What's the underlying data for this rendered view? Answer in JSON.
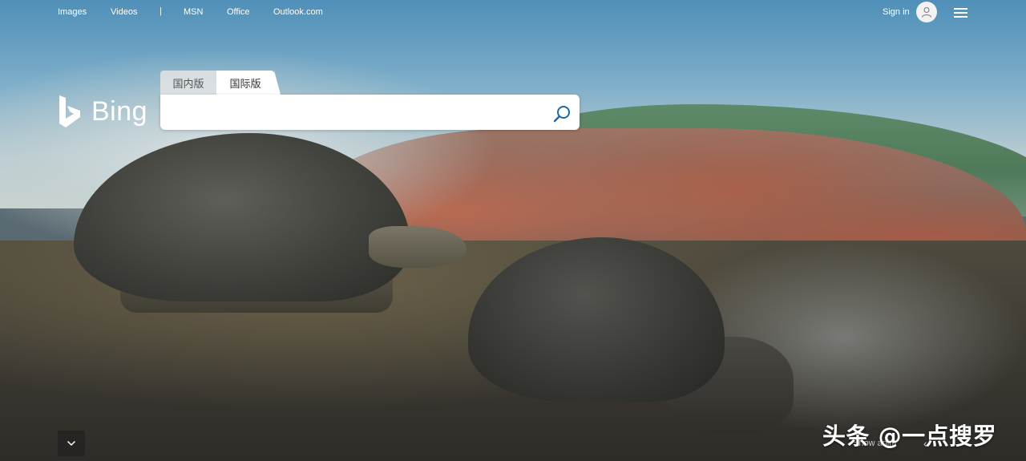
{
  "topnav": {
    "links": [
      "Images",
      "Videos",
      "MSN",
      "Office",
      "Outlook.com"
    ],
    "separator": "|",
    "signin_label": "Sign in"
  },
  "logo": {
    "text": "Bing"
  },
  "search": {
    "tabs": [
      {
        "label": "国内版",
        "active": false
      },
      {
        "label": "国际版",
        "active": true
      }
    ],
    "value": "",
    "placeholder": ""
  },
  "bottom": {
    "slideshow_text": "Show anim",
    "prev_glyph": "‹"
  },
  "watermark": "头条 @一点搜罗",
  "colors": {
    "accent": "#1a6aa8",
    "nav_text": "#ffffff"
  }
}
